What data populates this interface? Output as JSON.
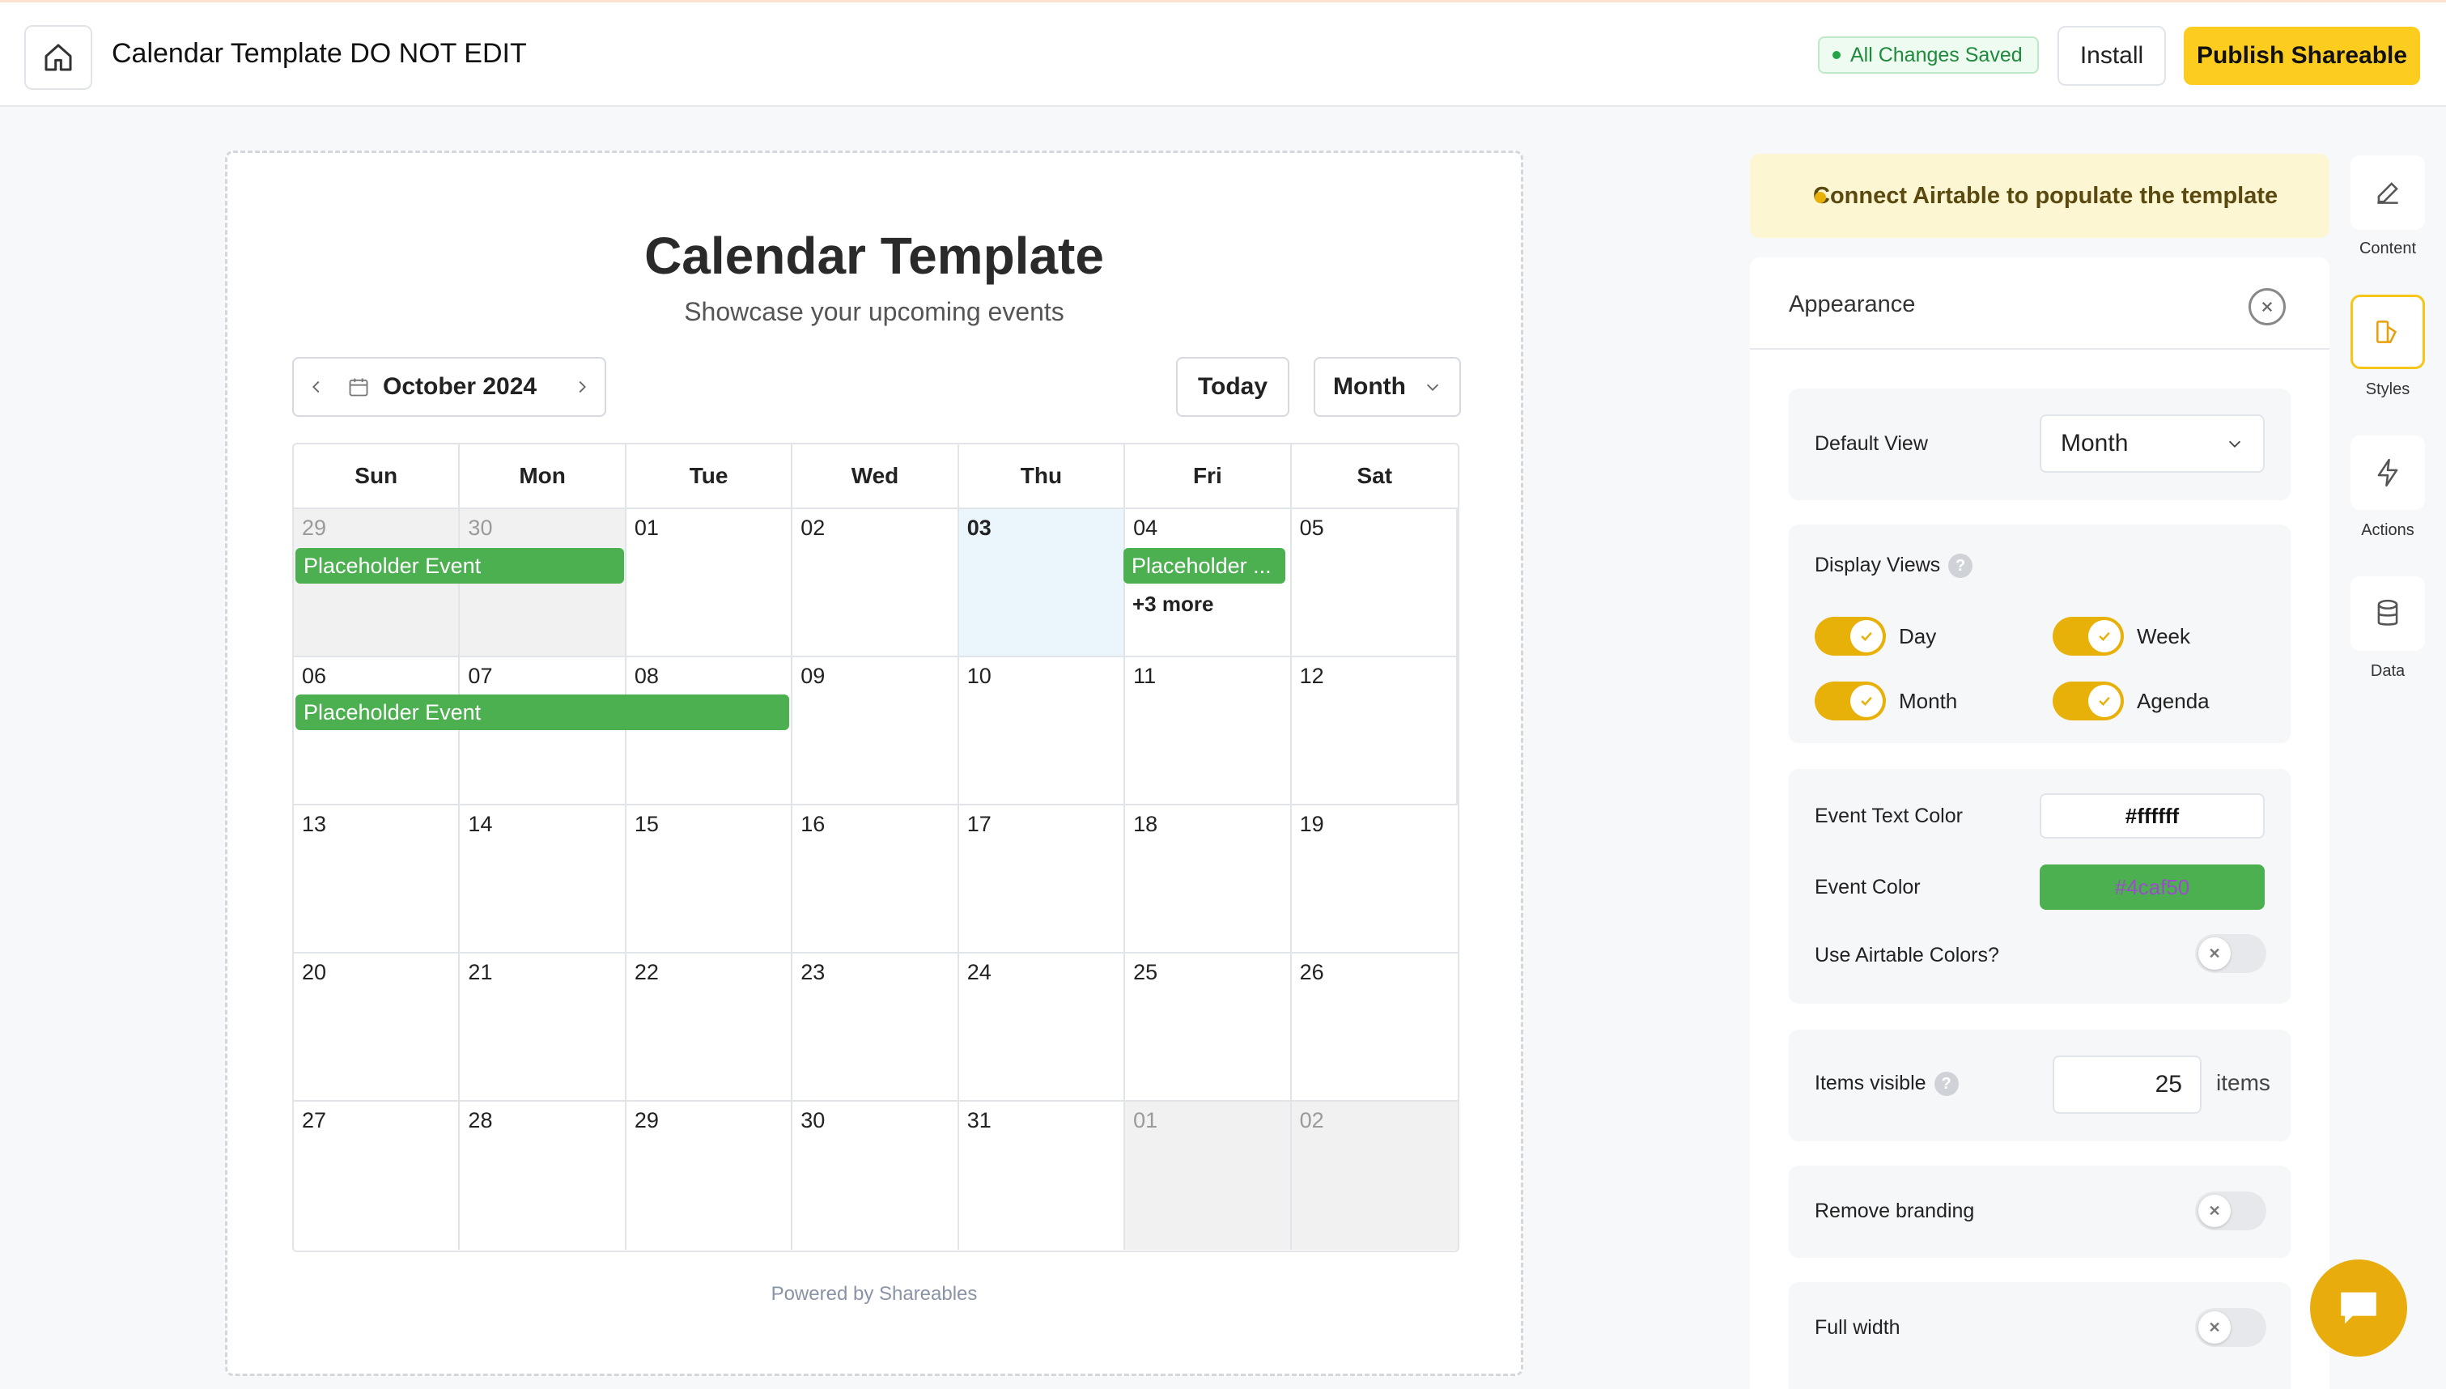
{
  "header": {
    "title": "Calendar Template DO NOT EDIT",
    "saved_status": "All Changes Saved",
    "install_label": "Install",
    "publish_label": "Publish Shareable"
  },
  "calendar": {
    "title": "Calendar Template",
    "subtitle": "Showcase your upcoming events",
    "month_label": "October 2024",
    "today_label": "Today",
    "view_label": "Month",
    "weekdays": [
      "Sun",
      "Mon",
      "Tue",
      "Wed",
      "Thu",
      "Fri",
      "Sat"
    ],
    "weeks": [
      [
        "29",
        "30",
        "01",
        "02",
        "03",
        "04",
        "05"
      ],
      [
        "06",
        "07",
        "08",
        "09",
        "10",
        "11",
        "12"
      ],
      [
        "13",
        "14",
        "15",
        "16",
        "17",
        "18",
        "19"
      ],
      [
        "20",
        "21",
        "22",
        "23",
        "24",
        "25",
        "26"
      ],
      [
        "27",
        "28",
        "29",
        "30",
        "31",
        "01",
        "02"
      ]
    ],
    "events": {
      "e1": "Placeholder Event",
      "e2": "Placeholder ...",
      "e3": "Placeholder Event",
      "more": "+3 more"
    },
    "powered_by": "Powered by Shareables"
  },
  "panel": {
    "banner": "Connect Airtable to populate the template",
    "title": "Appearance",
    "default_view_label": "Default View",
    "default_view_value": "Month",
    "display_views_label": "Display Views",
    "views": [
      "Day",
      "Week",
      "Month",
      "Agenda"
    ],
    "event_text_color_label": "Event Text Color",
    "event_text_color": "#ffffff",
    "event_color_label": "Event Color",
    "event_color": "#4caf50",
    "use_airtable_colors_label": "Use Airtable Colors?",
    "items_visible_label": "Items visible",
    "items_visible_value": "25",
    "items_unit": "items",
    "remove_branding_label": "Remove branding",
    "full_width_label": "Full width"
  },
  "rail": {
    "content": "Content",
    "styles": "Styles",
    "actions": "Actions",
    "data": "Data"
  },
  "colors": {
    "accent": "#fccc1e",
    "event_green": "#4caf50",
    "toggle_on": "#e8b10a"
  }
}
